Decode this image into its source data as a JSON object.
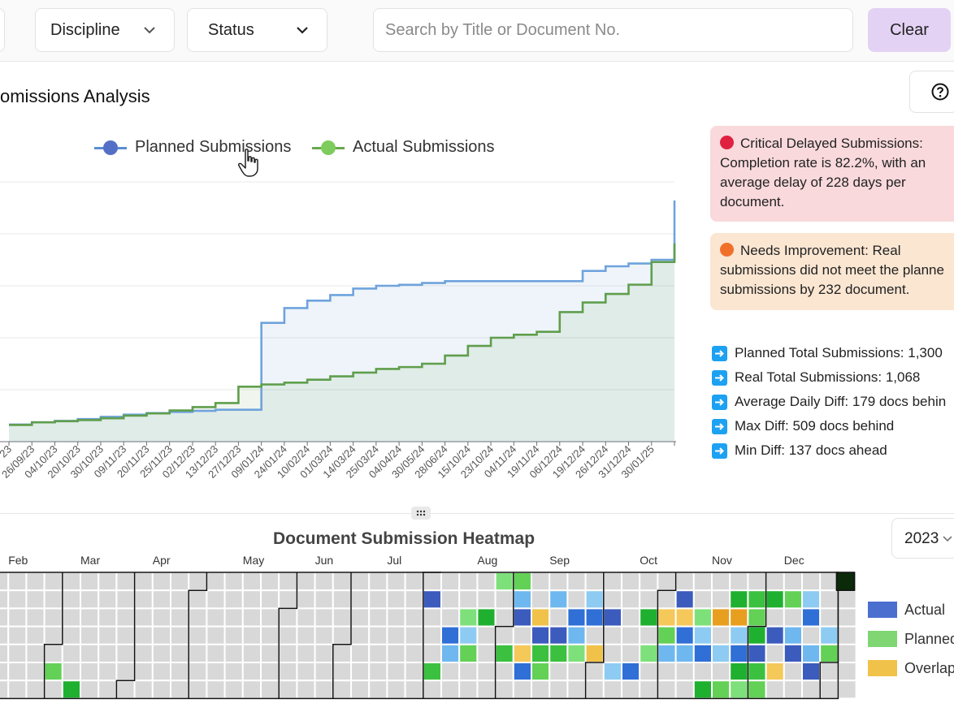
{
  "filters": {
    "discipline_label": "Discipline",
    "status_label": "Status",
    "search_placeholder": "Search by Title or Document No.",
    "clear_label": "Clear"
  },
  "section": {
    "title": "omissions Analysis"
  },
  "icons": {
    "dropdown": "chevron-down-icon",
    "help": "question-circle-icon",
    "cursor": "hand-pointer-icon",
    "stat_bullet": "arrow-right-icon",
    "drag": "drag-handle-icon"
  },
  "colors": {
    "planned": "#5b8fd1",
    "actual": "#6aa84f",
    "clear_button": "#e3d2f4",
    "critical_bg": "#f9d9dc",
    "critical_dot": "#e02040",
    "improve_bg": "#fbe6d2",
    "improve_dot": "#f0702a",
    "heat_actual": "#4a6fcf",
    "heat_planned": "#7fd673",
    "heat_overlap": "#f0c24a"
  },
  "chart_data": {
    "type": "line",
    "title": "",
    "xlabel": "",
    "ylabel": "",
    "legend_position": "top",
    "grid": true,
    "categories": [
      "23",
      "26/09/23",
      "04/10/23",
      "20/10/23",
      "30/10/23",
      "09/11/23",
      "20/11/23",
      "25/11/23",
      "02/12/23",
      "13/12/23",
      "27/12/23",
      "09/01/24",
      "24/01/24",
      "10/02/24",
      "01/03/24",
      "14/03/24",
      "25/03/24",
      "04/04/24",
      "30/05/24",
      "28/06/24",
      "15/10/24",
      "23/10/24",
      "04/11/24",
      "19/11/24",
      "06/12/24",
      "19/12/24",
      "26/12/24",
      "31/12/24",
      "30/01/25",
      ""
    ],
    "series": [
      {
        "name": "Planned Submissions",
        "values": [
          92,
          104,
          112,
          122,
          134,
          146,
          154,
          160,
          166,
          172,
          172,
          640,
          720,
          760,
          790,
          825,
          840,
          845,
          855,
          865,
          865,
          865,
          865,
          865,
          865,
          920,
          945,
          960,
          980,
          1300
        ]
      },
      {
        "name": "Actual Submissions",
        "values": [
          90,
          104,
          110,
          116,
          126,
          140,
          152,
          168,
          186,
          208,
          296,
          308,
          318,
          334,
          352,
          372,
          392,
          402,
          420,
          464,
          516,
          560,
          576,
          592,
          698,
          750,
          796,
          846,
          968,
          1068
        ]
      }
    ],
    "ylim": [
      0,
      1400
    ]
  },
  "alerts": {
    "critical": {
      "lines": [
        "Critical Delayed Submissions:",
        "Completion rate is 82.2%, with an",
        "average delay of 228 days per",
        "document."
      ]
    },
    "improvement": {
      "lines": [
        "Needs Improvement: Real",
        "submissions did not meet the planne",
        "submissions by 232 document."
      ]
    }
  },
  "stats": [
    "Planned Total Submissions: 1,300",
    "Real Total Submissions: 1,068",
    "Average Daily Diff: 179 docs behin",
    "Max Diff: 509 docs behind",
    "Min Diff: 137 docs ahead"
  ],
  "heatmap": {
    "title": "Document Submission Heatmap",
    "year": "2023",
    "months": [
      "Feb",
      "Mar",
      "Apr",
      "May",
      "Jun",
      "Jul",
      "Aug",
      "Sep",
      "Oct",
      "Nov",
      "Dec"
    ],
    "legend": [
      "Actual",
      "Planned",
      "Overlap"
    ],
    "cells": [
      {
        "w": 3,
        "d": 5,
        "s": "P"
      },
      {
        "w": 4,
        "d": 6,
        "s": "P"
      },
      {
        "w": 24,
        "d": 1,
        "s": "A"
      },
      {
        "w": 24,
        "d": 5,
        "s": "P"
      },
      {
        "w": 25,
        "d": 3,
        "s": "A"
      },
      {
        "w": 25,
        "d": 4,
        "s": "A"
      },
      {
        "w": 26,
        "d": 2,
        "s": "P"
      },
      {
        "w": 26,
        "d": 3,
        "s": "A"
      },
      {
        "w": 26,
        "d": 4,
        "s": "P"
      },
      {
        "w": 27,
        "d": 2,
        "s": "P"
      },
      {
        "w": 28,
        "d": 0,
        "s": "P"
      },
      {
        "w": 28,
        "d": 4,
        "s": "P"
      },
      {
        "w": 29,
        "d": 0,
        "s": "P"
      },
      {
        "w": 29,
        "d": 1,
        "s": "A"
      },
      {
        "w": 29,
        "d": 2,
        "s": "A"
      },
      {
        "w": 29,
        "d": 4,
        "s": "O"
      },
      {
        "w": 29,
        "d": 5,
        "s": "A"
      },
      {
        "w": 30,
        "d": 2,
        "s": "O"
      },
      {
        "w": 30,
        "d": 3,
        "s": "A"
      },
      {
        "w": 30,
        "d": 4,
        "s": "P"
      },
      {
        "w": 30,
        "d": 5,
        "s": "P"
      },
      {
        "w": 31,
        "d": 1,
        "s": "A"
      },
      {
        "w": 31,
        "d": 3,
        "s": "A"
      },
      {
        "w": 31,
        "d": 4,
        "s": "P"
      },
      {
        "w": 32,
        "d": 2,
        "s": "A"
      },
      {
        "w": 32,
        "d": 3,
        "s": "A"
      },
      {
        "w": 32,
        "d": 4,
        "s": "P"
      },
      {
        "w": 33,
        "d": 1,
        "s": "A"
      },
      {
        "w": 33,
        "d": 2,
        "s": "A"
      },
      {
        "w": 33,
        "d": 4,
        "s": "O"
      },
      {
        "w": 34,
        "d": 2,
        "s": "A"
      },
      {
        "w": 34,
        "d": 5,
        "s": "A"
      },
      {
        "w": 35,
        "d": 5,
        "s": "A"
      },
      {
        "w": 36,
        "d": 2,
        "s": "P"
      },
      {
        "w": 36,
        "d": 4,
        "s": "P"
      },
      {
        "w": 37,
        "d": 2,
        "s": "O"
      },
      {
        "w": 37,
        "d": 3,
        "s": "P"
      },
      {
        "w": 37,
        "d": 4,
        "s": "A"
      },
      {
        "w": 38,
        "d": 1,
        "s": "A"
      },
      {
        "w": 38,
        "d": 2,
        "s": "O"
      },
      {
        "w": 38,
        "d": 3,
        "s": "A"
      },
      {
        "w": 38,
        "d": 4,
        "s": "A"
      },
      {
        "w": 39,
        "d": 2,
        "s": "P"
      },
      {
        "w": 39,
        "d": 3,
        "s": "A"
      },
      {
        "w": 39,
        "d": 4,
        "s": "A"
      },
      {
        "w": 39,
        "d": 6,
        "s": "P"
      },
      {
        "w": 40,
        "d": 2,
        "s": "O"
      },
      {
        "w": 40,
        "d": 4,
        "s": "A"
      },
      {
        "w": 40,
        "d": 6,
        "s": "P"
      },
      {
        "w": 41,
        "d": 1,
        "s": "P"
      },
      {
        "w": 41,
        "d": 2,
        "s": "O"
      },
      {
        "w": 41,
        "d": 3,
        "s": "A"
      },
      {
        "w": 41,
        "d": 4,
        "s": "A"
      },
      {
        "w": 41,
        "d": 5,
        "s": "P"
      },
      {
        "w": 41,
        "d": 6,
        "s": "P"
      },
      {
        "w": 42,
        "d": 1,
        "s": "P"
      },
      {
        "w": 42,
        "d": 2,
        "s": "P"
      },
      {
        "w": 42,
        "d": 3,
        "s": "P"
      },
      {
        "w": 42,
        "d": 4,
        "s": "A"
      },
      {
        "w": 42,
        "d": 5,
        "s": "P"
      },
      {
        "w": 42,
        "d": 6,
        "s": "P"
      },
      {
        "w": 43,
        "d": 1,
        "s": "P"
      },
      {
        "w": 43,
        "d": 3,
        "s": "A"
      },
      {
        "w": 43,
        "d": 5,
        "s": "O"
      },
      {
        "w": 44,
        "d": 1,
        "s": "P"
      },
      {
        "w": 44,
        "d": 3,
        "s": "A"
      },
      {
        "w": 44,
        "d": 4,
        "s": "A"
      },
      {
        "w": 45,
        "d": 1,
        "s": "A"
      },
      {
        "w": 45,
        "d": 2,
        "s": "A"
      },
      {
        "w": 45,
        "d": 4,
        "s": "A"
      },
      {
        "w": 45,
        "d": 5,
        "s": "A"
      },
      {
        "w": 46,
        "d": 3,
        "s": "A"
      },
      {
        "w": 46,
        "d": 4,
        "s": "P"
      }
    ]
  }
}
